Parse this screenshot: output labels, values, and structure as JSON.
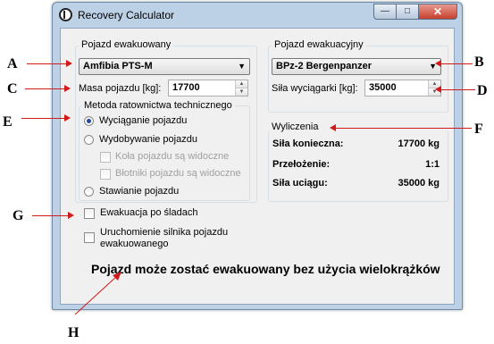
{
  "window": {
    "title": "Recovery Calculator",
    "buttons": {
      "minimize": "—",
      "maximize": "□",
      "close": "✕"
    }
  },
  "recovered_vehicle": {
    "group_label": "Pojazd ewakuowany",
    "selected": "Amfibia PTS-M",
    "mass_label": "Masa pojazdu [kg]:",
    "mass_value": "17700"
  },
  "rescue_method": {
    "group_label": "Metoda ratownictwa technicznego",
    "options": [
      {
        "label": "Wyciąganie pojazdu",
        "checked": true
      },
      {
        "label": "Wydobywanie pojazdu",
        "checked": false
      },
      {
        "label": "Stawianie pojazdu",
        "checked": false
      }
    ],
    "sub_options": [
      {
        "label": "Koła pojazdu są widoczne",
        "checked": false,
        "enabled": false
      },
      {
        "label": "Błotniki pojazdu są widoczne",
        "checked": false,
        "enabled": false
      }
    ]
  },
  "options": {
    "track_evacuation": {
      "label": "Ewakuacja po śladach",
      "checked": false
    },
    "engine_start": {
      "label_line1": "Uruchomienie silnika pojazdu",
      "label_line2": "ewakuowanego",
      "checked": false
    }
  },
  "recovery_vehicle": {
    "group_label": "Pojazd ewakuacyjny",
    "selected": "BPz-2 Bergenpanzer",
    "winch_label": "Siła wyciągarki [kg]:",
    "winch_value": "35000"
  },
  "calculations": {
    "group_label": "Wyliczenia",
    "rows": [
      {
        "label": "Siła konieczna:",
        "value": "17700 kg"
      },
      {
        "label": "Przełożenie:",
        "value": "1:1"
      },
      {
        "label": "Siła uciągu:",
        "value": "35000 kg"
      }
    ]
  },
  "message": "Pojazd może zostać ewakuowany bez użycia wielokrążków",
  "annotations": {
    "A": "A",
    "B": "B",
    "C": "C",
    "D": "D",
    "E": "E",
    "F": "F",
    "G": "G",
    "H": "H"
  },
  "colors": {
    "annotation_arrow": "#d11a1a",
    "window_frame": "#bcd0e6",
    "client_bg": "#f0f0f0"
  }
}
